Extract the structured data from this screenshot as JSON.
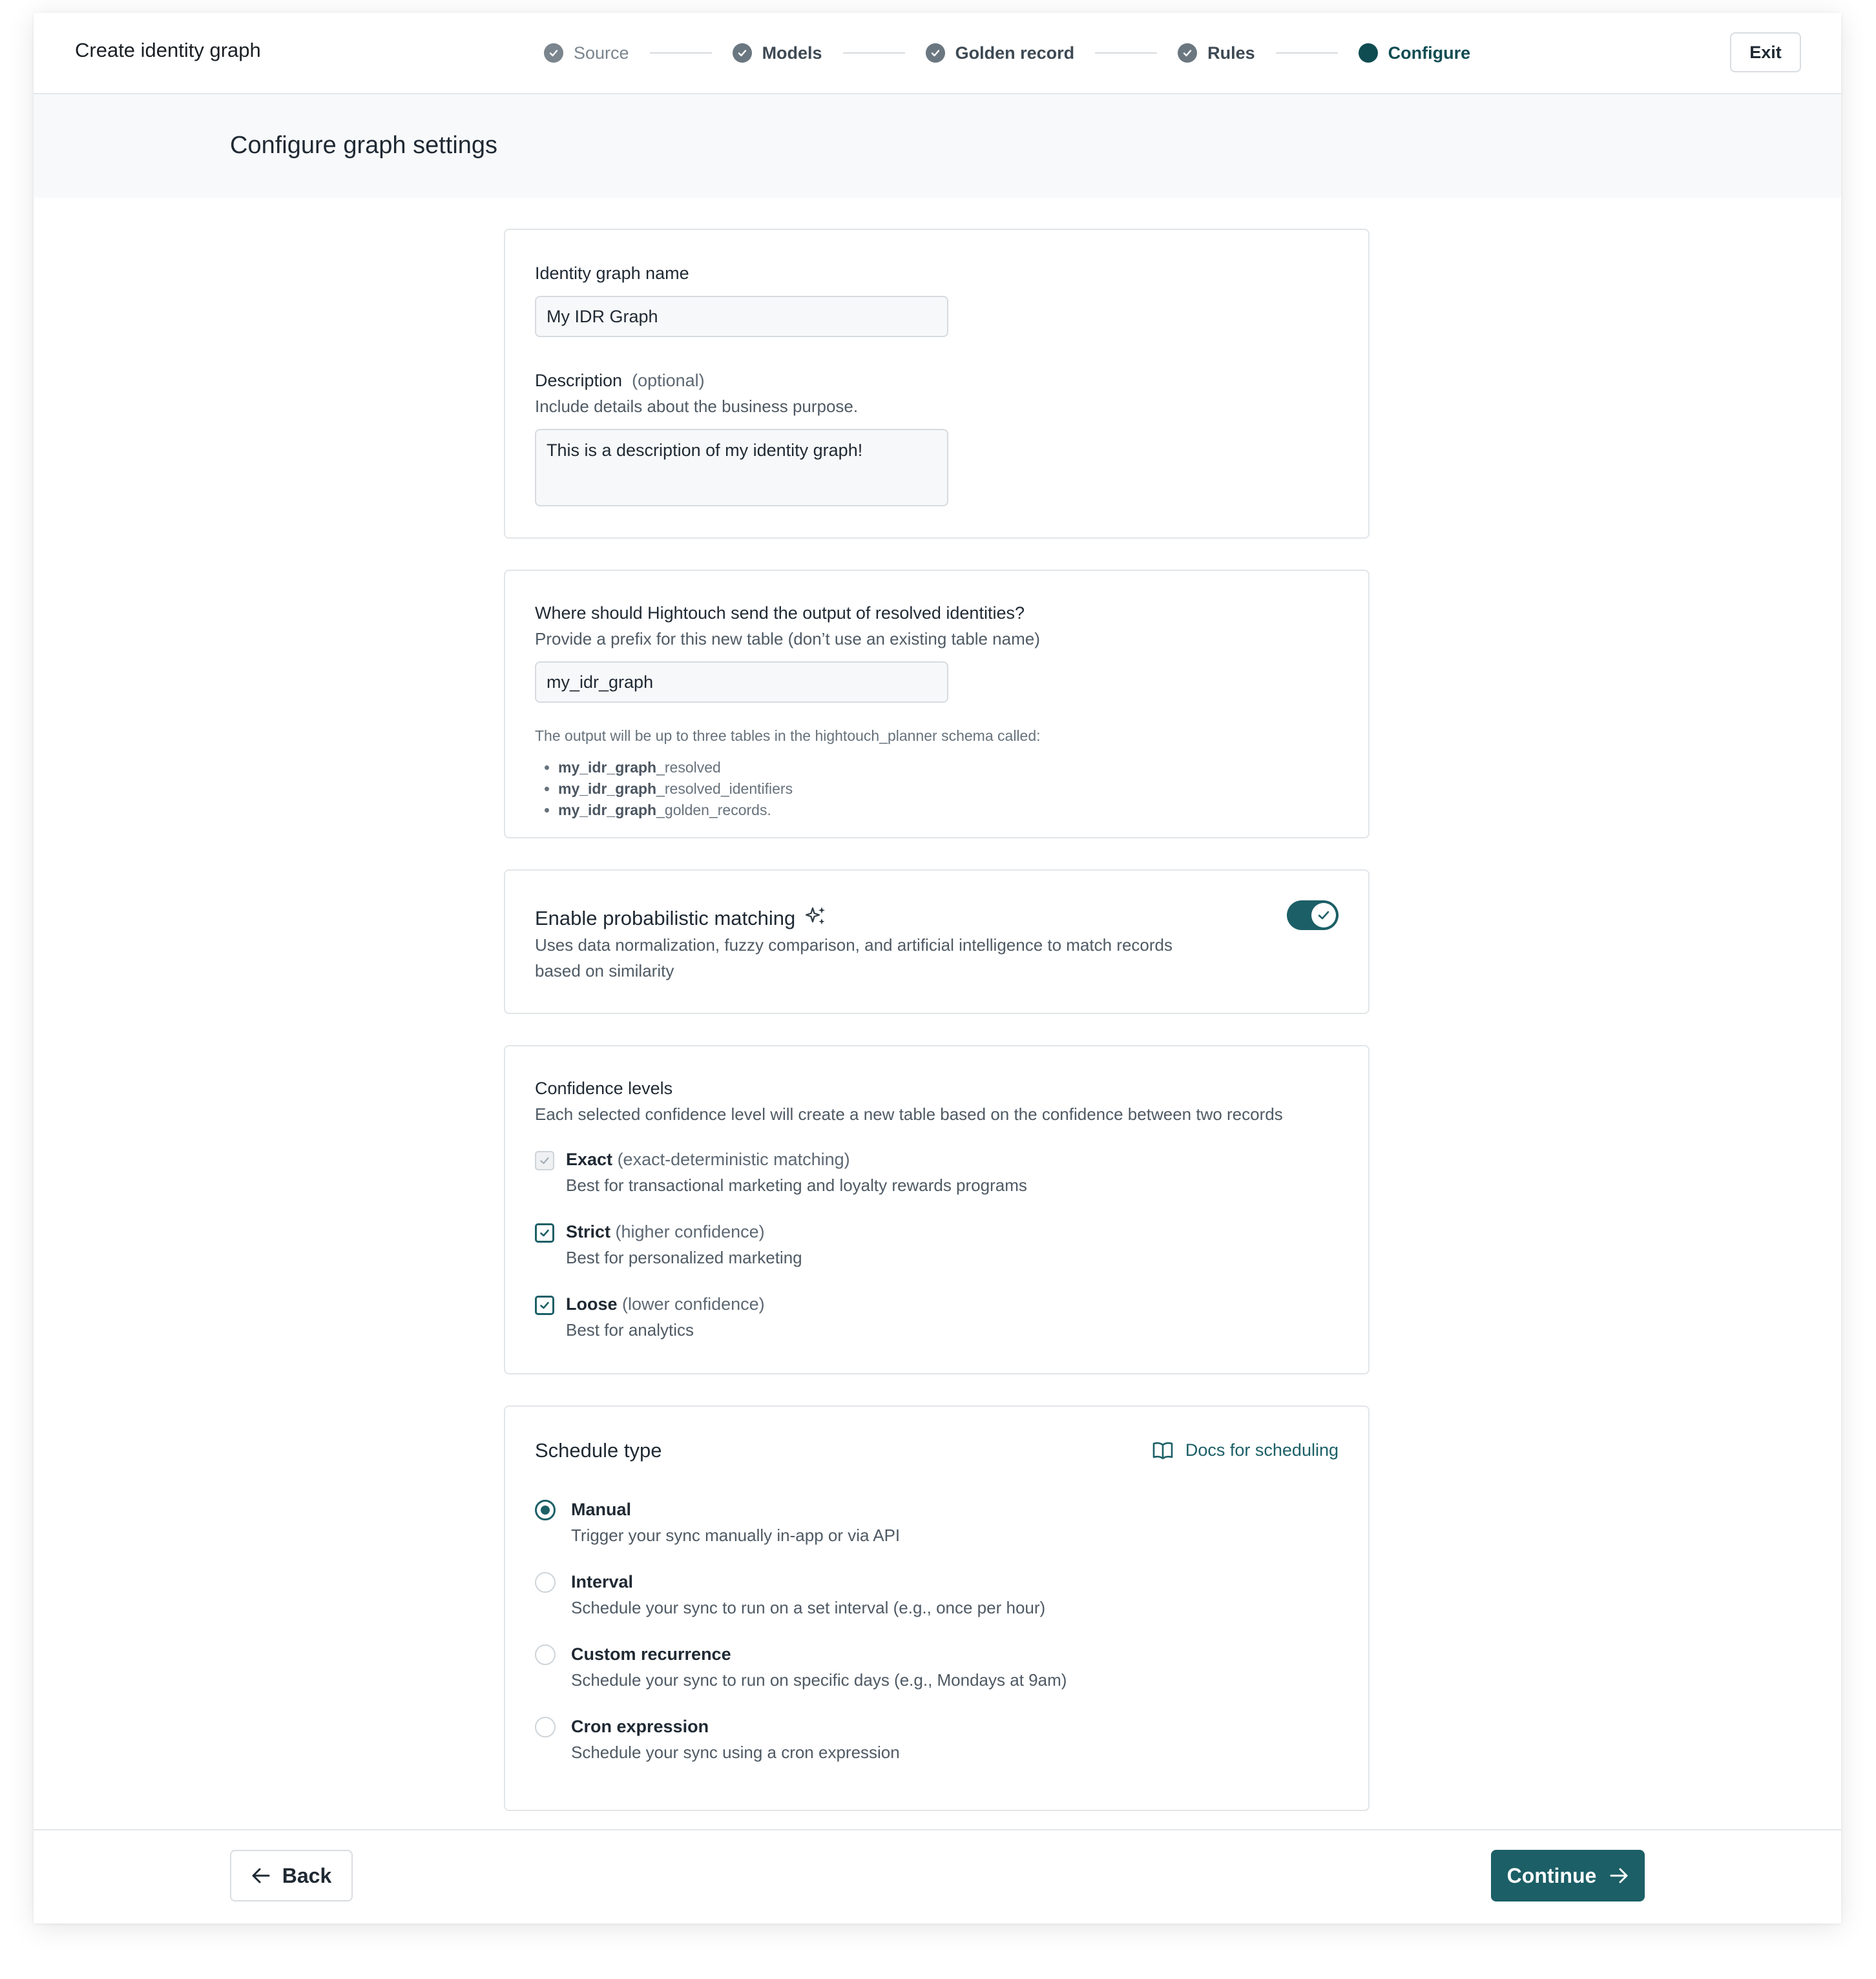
{
  "header": {
    "title": "Create identity graph",
    "exit_label": "Exit",
    "steps": [
      {
        "label": "Source",
        "state": "complete"
      },
      {
        "label": "Models",
        "state": "complete"
      },
      {
        "label": "Golden record",
        "state": "complete"
      },
      {
        "label": "Rules",
        "state": "complete"
      },
      {
        "label": "Configure",
        "state": "active"
      }
    ]
  },
  "page_title": "Configure graph settings",
  "name_section": {
    "name_label": "Identity graph name",
    "name_value": "My IDR Graph",
    "description_label": "Description",
    "description_optional": "(optional)",
    "description_help": "Include details about the business purpose.",
    "description_value": "This is a description of my identity graph!"
  },
  "output_section": {
    "label": "Where should Hightouch send the output of resolved identities?",
    "help": "Provide a prefix for this new table (don’t use an existing table name)",
    "prefix_value": "my_idr_graph",
    "note": "The output will be up to three tables in the hightouch_planner schema called:",
    "tables": [
      {
        "prefix": "my_idr_graph",
        "suffix": "_resolved"
      },
      {
        "prefix": "my_idr_graph",
        "suffix": "_resolved_identifiers"
      },
      {
        "prefix": "my_idr_graph",
        "suffix": "_golden_records."
      }
    ]
  },
  "probabilistic": {
    "title": "Enable probabilistic matching",
    "icon": "sparkles-icon",
    "description_line1": "Uses data normalization, fuzzy comparison, and artificial intelligence to match records",
    "description_line2": "based on similarity",
    "enabled": true
  },
  "confidence": {
    "title": "Confidence levels",
    "help": "Each selected confidence level will create a new table based on the confidence between two records",
    "levels": [
      {
        "name": "Exact",
        "qualifier": " (exact-deterministic matching)",
        "desc": "Best for transactional marketing and loyalty rewards programs",
        "checked": true,
        "disabled": true
      },
      {
        "name": "Strict",
        "qualifier": " (higher confidence)",
        "desc": "Best for personalized marketing",
        "checked": true,
        "disabled": false
      },
      {
        "name": "Loose",
        "qualifier": " (lower confidence)",
        "desc": "Best for analytics",
        "checked": true,
        "disabled": false
      }
    ]
  },
  "schedule": {
    "title": "Schedule type",
    "docs_label": "Docs for scheduling",
    "options": [
      {
        "name": "Manual",
        "desc": "Trigger your sync manually in-app or via API",
        "selected": true
      },
      {
        "name": "Interval",
        "desc": "Schedule your sync to run on a set interval (e.g., once per hour)",
        "selected": false
      },
      {
        "name": "Custom recurrence",
        "desc": "Schedule your sync to run on specific days (e.g., Mondays at 9am)",
        "selected": false
      },
      {
        "name": "Cron expression",
        "desc": "Schedule your sync using a cron expression",
        "selected": false
      }
    ]
  },
  "footer": {
    "back_label": "Back",
    "continue_label": "Continue"
  },
  "colors": {
    "accent": "#1c5f66",
    "active_step": "#0f4c52",
    "subheader_bg": "#f8f9fa"
  }
}
